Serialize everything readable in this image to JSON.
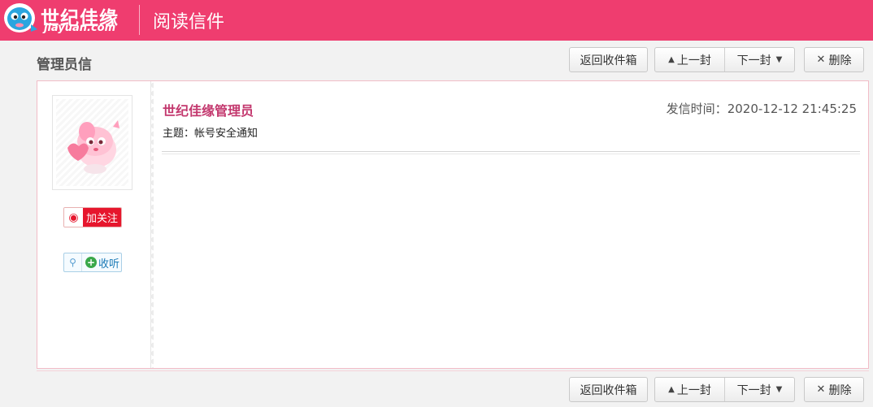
{
  "header": {
    "logo_cn": "世纪佳缘",
    "logo_en": "jiayuan.com",
    "title": "阅读信件"
  },
  "page": {
    "title": "管理员信"
  },
  "toolbar": {
    "back_label": "返回收件箱",
    "prev_label": "上一封",
    "next_label": "下一封",
    "delete_label": "删除"
  },
  "sidebar": {
    "weibo_label": "加关注",
    "tqq_label": "收听"
  },
  "message": {
    "sender": "世纪佳缘管理员",
    "sent_time_label": "发信时间：",
    "sent_time": "2020-12-12 21:45:25",
    "subject_label": "主题：",
    "subject": "帐号安全通知"
  },
  "colors": {
    "header_bg": "#ef3d6f",
    "sender_text": "#c3386e",
    "weibo_red": "#e6162d"
  },
  "icons": {
    "logo": "jiayuan-mascot-icon",
    "prev": "triangle-up-icon",
    "next": "triangle-down-icon",
    "delete": "close-icon",
    "weibo": "weibo-icon",
    "tqq": "tencent-weibo-icon",
    "plus": "plus-circle-icon"
  }
}
